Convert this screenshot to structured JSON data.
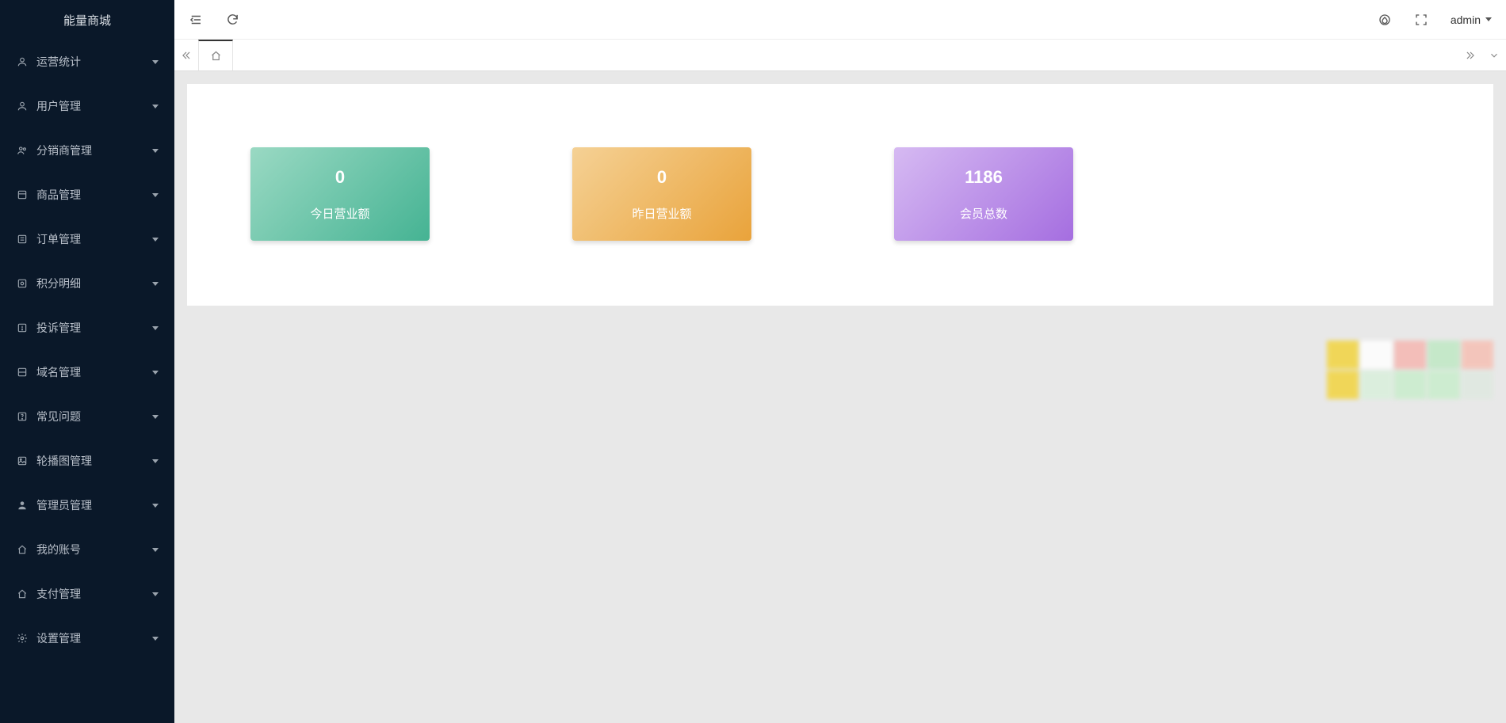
{
  "app_title": "能量商城",
  "user_name": "admin",
  "sidebar": {
    "items": [
      {
        "label": "运营统计",
        "icon": "user-icon"
      },
      {
        "label": "用户管理",
        "icon": "user-icon"
      },
      {
        "label": "分销商管理",
        "icon": "users-icon"
      },
      {
        "label": "商品管理",
        "icon": "product-icon"
      },
      {
        "label": "订单管理",
        "icon": "order-icon"
      },
      {
        "label": "积分明细",
        "icon": "detail-icon"
      },
      {
        "label": "投诉管理",
        "icon": "complaint-icon"
      },
      {
        "label": "域名管理",
        "icon": "domain-icon"
      },
      {
        "label": "常见问题",
        "icon": "faq-icon"
      },
      {
        "label": "轮播图管理",
        "icon": "carousel-icon"
      },
      {
        "label": "管理员管理",
        "icon": "admin-icon"
      },
      {
        "label": "我的账号",
        "icon": "account-icon"
      },
      {
        "label": "支付管理",
        "icon": "payment-icon"
      },
      {
        "label": "设置管理",
        "icon": "settings-icon"
      }
    ]
  },
  "stats": [
    {
      "value": "0",
      "label": "今日营业额",
      "tone": "green"
    },
    {
      "value": "0",
      "label": "昨日营业额",
      "tone": "orange"
    },
    {
      "value": "1186",
      "label": "会员总数",
      "tone": "purple"
    }
  ]
}
